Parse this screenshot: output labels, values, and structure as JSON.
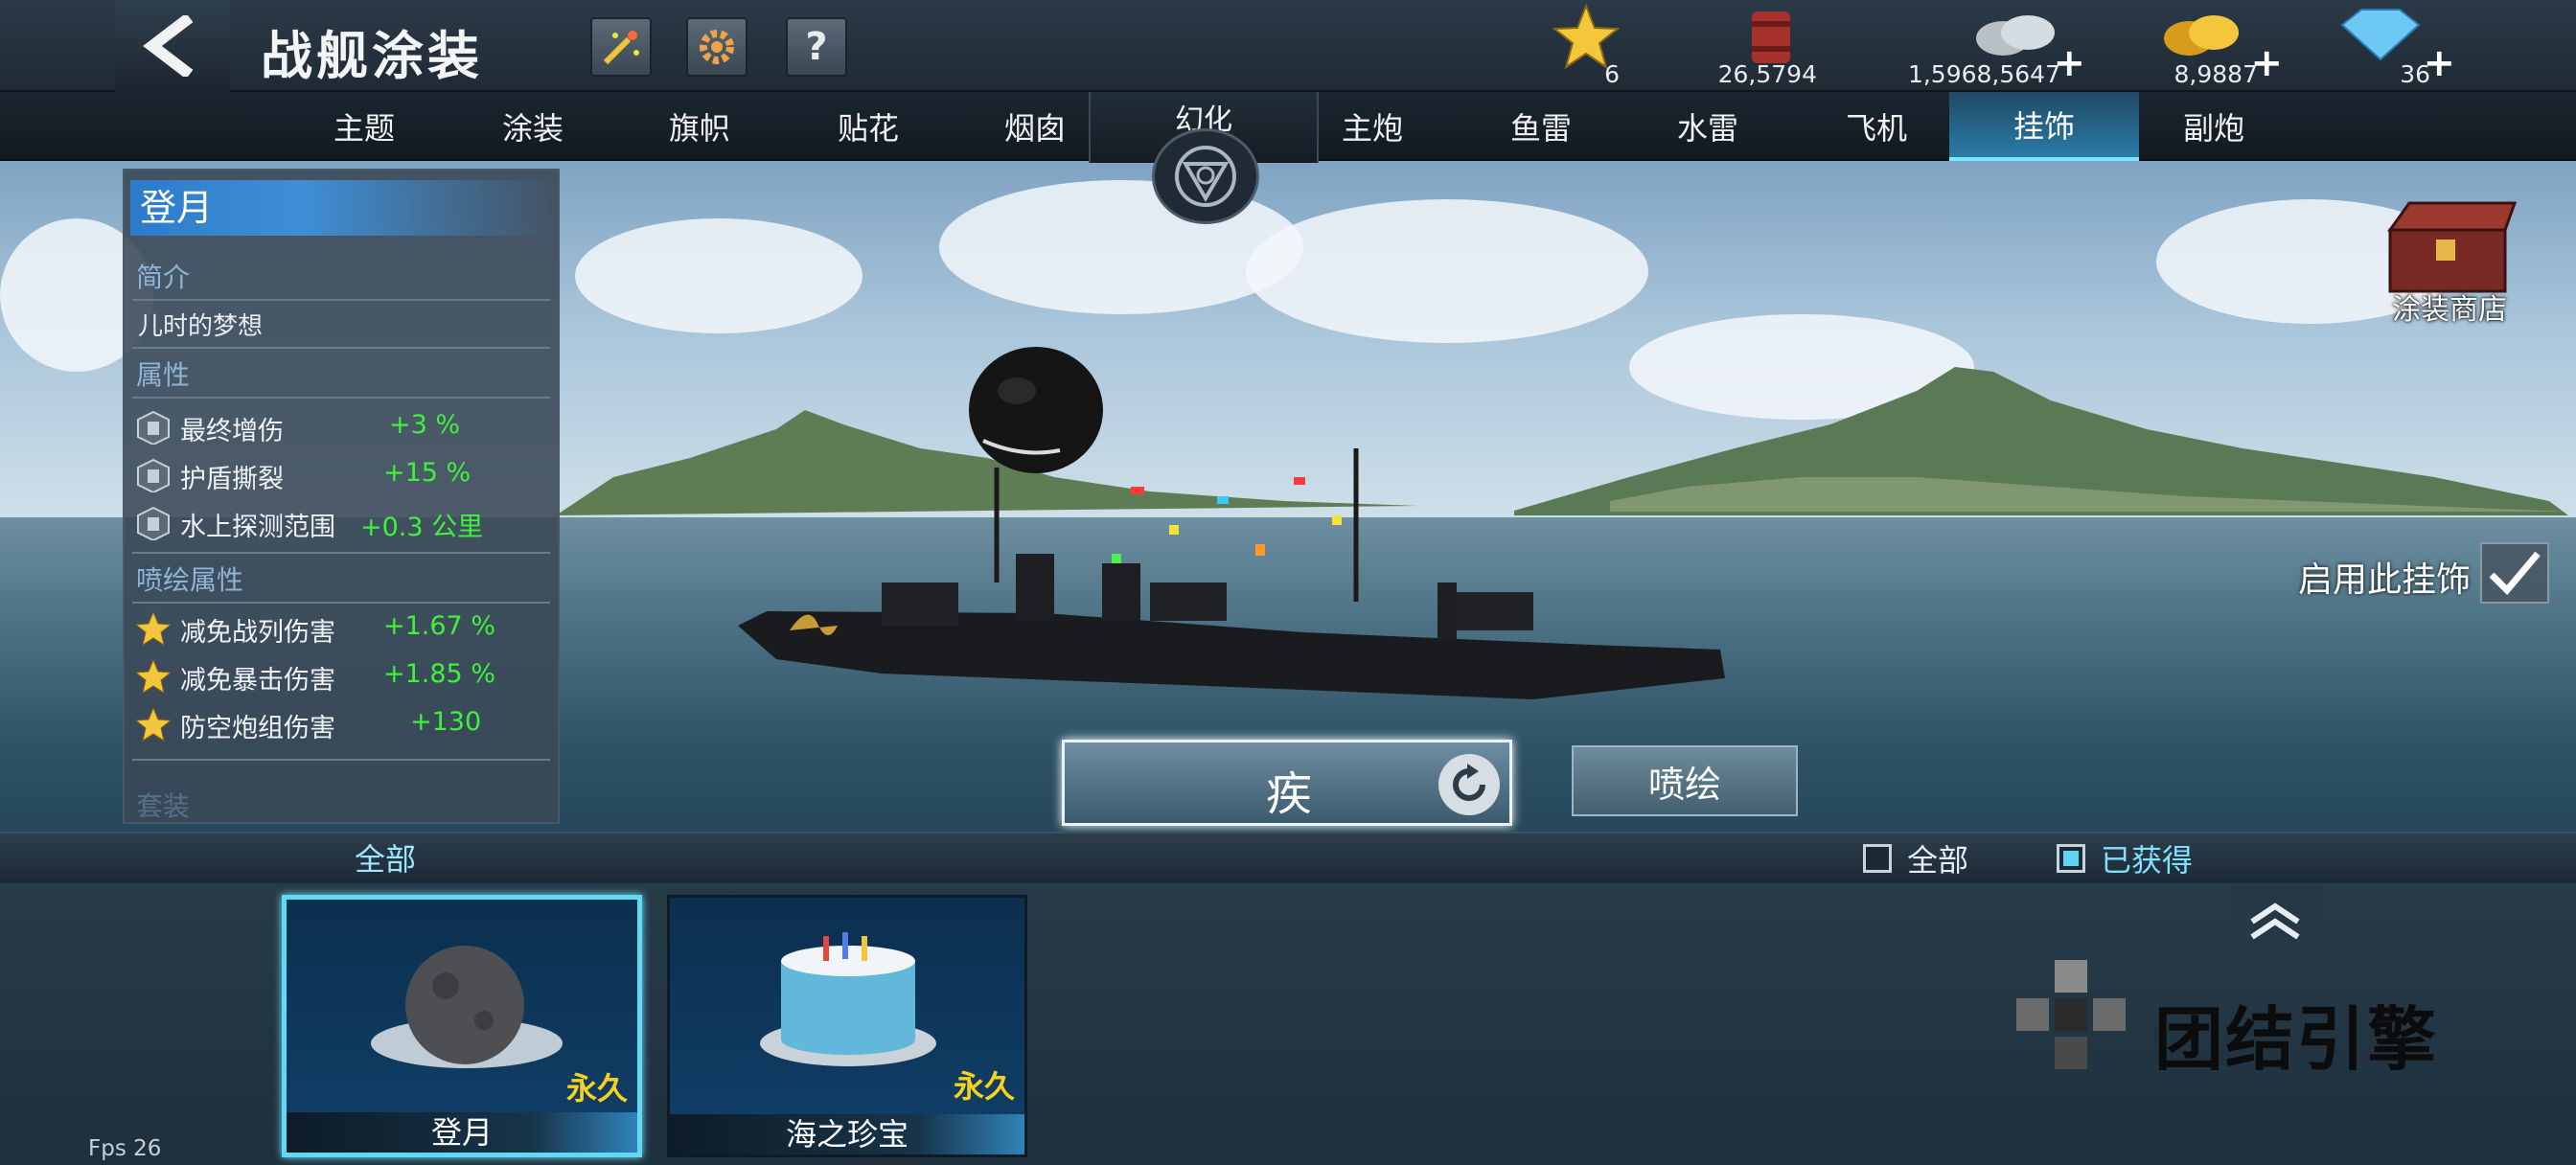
{
  "header": {
    "title": "战舰涂装",
    "buttons": [
      "firework-icon",
      "gear-icon",
      "help-icon"
    ],
    "help_label": "?"
  },
  "resources": [
    {
      "name": "star-icon",
      "value": "6"
    },
    {
      "name": "fuel-barrel-icon",
      "value": "26,5794"
    },
    {
      "name": "silver-coins-icon",
      "value": "1,5968,5647",
      "plus": "+"
    },
    {
      "name": "gold-coins-icon",
      "value": "8,9887",
      "plus": "+"
    },
    {
      "name": "diamond-icon",
      "value": "36",
      "plus": "+"
    }
  ],
  "tabs_left": [
    "主题",
    "涂装",
    "旗帜",
    "贴花",
    "烟囱"
  ],
  "tab_center": "幻化",
  "tabs_right": [
    "主炮",
    "鱼雷",
    "水雷",
    "飞机",
    "挂饰",
    "副炮"
  ],
  "active_tab": "挂饰",
  "info": {
    "name": "登月",
    "intro_title": "简介",
    "intro_text": "儿时的梦想",
    "attr_title": "属性",
    "attrs": [
      {
        "label": "最终增伤",
        "value": "+3 %"
      },
      {
        "label": "护盾撕裂",
        "value": "+15 %"
      },
      {
        "label": "水上探测范围",
        "value": "+0.3 公里"
      }
    ],
    "paint_title": "喷绘属性",
    "paint_attrs": [
      {
        "label": "减免战列伤害",
        "value": "+1.67 %"
      },
      {
        "label": "减免暴击伤害",
        "value": "+1.85 %"
      },
      {
        "label": "防空炮组伤害",
        "value": "+130"
      }
    ],
    "cut_text": "套装"
  },
  "shop_label": "涂装商店",
  "enable_label": "启用此挂饰",
  "style_button": "疾",
  "paint_button": "喷绘",
  "filter": {
    "tab": "全部",
    "options": [
      {
        "label": "全部",
        "checked": false
      },
      {
        "label": "已获得",
        "checked": true
      }
    ]
  },
  "items": [
    {
      "name": "登月",
      "tag": "永久",
      "selected": true
    },
    {
      "name": "海之珍宝",
      "tag": "永久",
      "selected": false
    }
  ],
  "brand_text": "团结引擎",
  "fps": "Fps 26"
}
